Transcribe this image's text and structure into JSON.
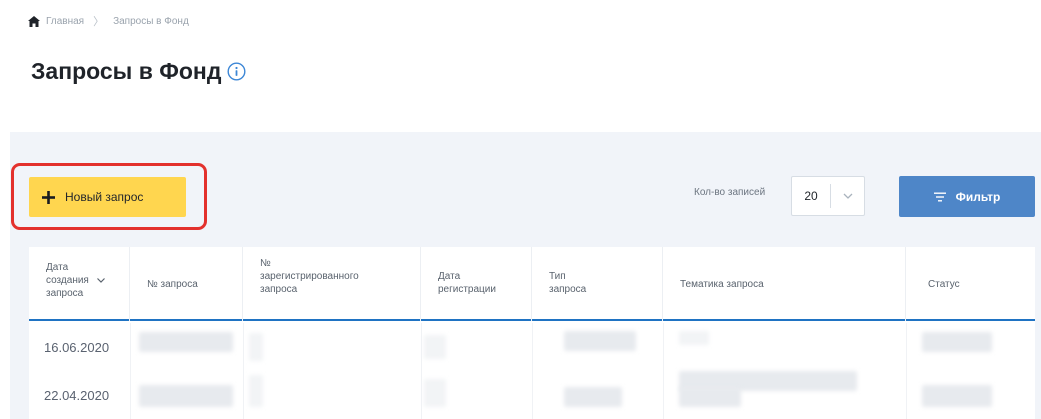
{
  "breadcrumb": {
    "home": "Главная",
    "current": "Запросы в Фонд"
  },
  "page": {
    "title": "Запросы в Фонд"
  },
  "toolbar": {
    "new_request_label": "Новый запрос",
    "records_label": "Кол-во записей",
    "records_value": "20",
    "filter_label": "Фильтр"
  },
  "table": {
    "headers": [
      "Дата создания запроса",
      "№ запроса",
      "№ зарегистрированного запроса",
      "Дата регистрации",
      "Тип запроса",
      "Тематика запроса",
      "Статус"
    ],
    "header_lines": {
      "date_1": "Дата",
      "date_2": "создания",
      "date_3": "запроса",
      "reg_1": "№",
      "reg_2": "зарегистрированного",
      "reg_3": "запроса",
      "regdate_1": "Дата",
      "regdate_2": "регистрации",
      "type_1": "Тип",
      "type_2": "запроса"
    },
    "rows": [
      {
        "date": "16.06.2020"
      },
      {
        "date": "22.04.2020"
      }
    ]
  },
  "colors": {
    "accent_yellow": "#ffd64f",
    "highlight_red": "#e3312d",
    "filter_blue": "#4e86c8",
    "header_underline": "#1f73c3",
    "panel_bg": "#f1f4f9"
  },
  "icons": [
    "home-icon",
    "info-icon",
    "plus-icon",
    "chevron-down-icon",
    "filter-icon",
    "sort-down-icon"
  ]
}
